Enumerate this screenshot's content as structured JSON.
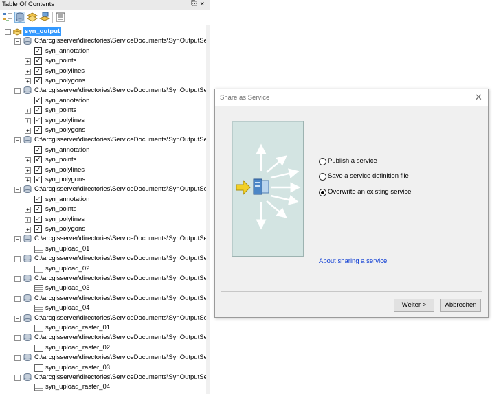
{
  "toc": {
    "title": "Table Of Contents",
    "root_label": "syn_output",
    "groups": [
      {
        "path": "C:\\arcgisserver\\directories\\ServiceDocuments\\SynOutputSe",
        "children": [
          {
            "label": "syn_annotation",
            "checked": true,
            "expandable": false
          },
          {
            "label": "syn_points",
            "checked": true,
            "expandable": true
          },
          {
            "label": "syn_polylines",
            "checked": true,
            "expandable": true
          },
          {
            "label": "syn_polygons",
            "checked": true,
            "expandable": true
          }
        ]
      },
      {
        "path": "C:\\arcgisserver\\directories\\ServiceDocuments\\SynOutputSe",
        "children": [
          {
            "label": "syn_annotation",
            "checked": true,
            "expandable": false
          },
          {
            "label": "syn_points",
            "checked": true,
            "expandable": true
          },
          {
            "label": "syn_polylines",
            "checked": true,
            "expandable": true
          },
          {
            "label": "syn_polygons",
            "checked": true,
            "expandable": true
          }
        ]
      },
      {
        "path": "C:\\arcgisserver\\directories\\ServiceDocuments\\SynOutputSe",
        "children": [
          {
            "label": "syn_annotation",
            "checked": true,
            "expandable": false
          },
          {
            "label": "syn_points",
            "checked": true,
            "expandable": true
          },
          {
            "label": "syn_polylines",
            "checked": true,
            "expandable": true
          },
          {
            "label": "syn_polygons",
            "checked": true,
            "expandable": true
          }
        ]
      },
      {
        "path": "C:\\arcgisserver\\directories\\ServiceDocuments\\SynOutputSe",
        "children": [
          {
            "label": "syn_annotation",
            "checked": true,
            "expandable": false
          },
          {
            "label": "syn_points",
            "checked": true,
            "expandable": true
          },
          {
            "label": "syn_polylines",
            "checked": true,
            "expandable": true
          },
          {
            "label": "syn_polygons",
            "checked": true,
            "expandable": true
          }
        ]
      },
      {
        "path": "C:\\arcgisserver\\directories\\ServiceDocuments\\SynOutputSe",
        "children": [
          {
            "label": "syn_upload_01",
            "table": true
          }
        ]
      },
      {
        "path": "C:\\arcgisserver\\directories\\ServiceDocuments\\SynOutputSe",
        "children": [
          {
            "label": "syn_upload_02",
            "table": true
          }
        ]
      },
      {
        "path": "C:\\arcgisserver\\directories\\ServiceDocuments\\SynOutputSe",
        "children": [
          {
            "label": "syn_upload_03",
            "table": true
          }
        ]
      },
      {
        "path": "C:\\arcgisserver\\directories\\ServiceDocuments\\SynOutputSe",
        "children": [
          {
            "label": "syn_upload_04",
            "table": true
          }
        ]
      },
      {
        "path": "C:\\arcgisserver\\directories\\ServiceDocuments\\SynOutputSe",
        "children": [
          {
            "label": "syn_upload_raster_01",
            "table": true
          }
        ]
      },
      {
        "path": "C:\\arcgisserver\\directories\\ServiceDocuments\\SynOutputSe",
        "children": [
          {
            "label": "syn_upload_raster_02",
            "table": true
          }
        ]
      },
      {
        "path": "C:\\arcgisserver\\directories\\ServiceDocuments\\SynOutputSe",
        "children": [
          {
            "label": "syn_upload_raster_03",
            "table": true
          }
        ]
      },
      {
        "path": "C:\\arcgisserver\\directories\\ServiceDocuments\\SynOutputSe",
        "children": [
          {
            "label": "syn_upload_raster_04",
            "table": true
          }
        ]
      }
    ]
  },
  "dialog": {
    "title": "Share as Service",
    "options": [
      {
        "label": "Publish a service",
        "selected": false
      },
      {
        "label": "Save a service definition file",
        "selected": false
      },
      {
        "label": "Overwrite an existing service",
        "selected": true
      }
    ],
    "link": "About sharing a service",
    "next_label": "Weiter >",
    "cancel_label": "Abbrechen"
  },
  "colors": {
    "selection": "#3399ff",
    "link": "#0b3bd3",
    "art_bg": "#d3e4e2"
  },
  "icons": [
    "list-by-drawing-order-icon",
    "list-by-source-icon",
    "list-by-visibility-icon",
    "list-by-selection-icon",
    "options-icon",
    "pin-icon",
    "close-icon",
    "expand-icon",
    "checkbox-icon",
    "database-icon",
    "table-icon",
    "layers-icon",
    "share-service-illustration"
  ]
}
